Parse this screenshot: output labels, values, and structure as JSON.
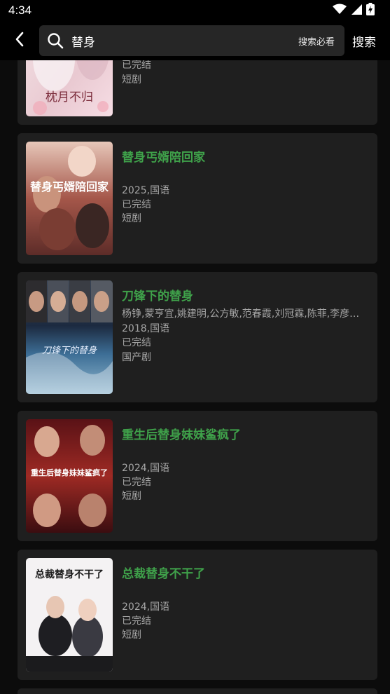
{
  "status_bar": {
    "time": "4:34"
  },
  "search": {
    "query": "替身",
    "hint": "搜索必看",
    "submit_label": "搜索"
  },
  "results": [
    {
      "title": "",
      "cast": "",
      "year_lang": "",
      "status": "已完结",
      "category": "短剧",
      "poster_text": "枕月不归"
    },
    {
      "title": "替身丐婿陪回家",
      "cast": "",
      "year_lang": "2025,国语",
      "status": "已完结",
      "category": "短剧",
      "poster_text": "替身丐婿陪回家"
    },
    {
      "title": "刀锋下的替身",
      "cast": "杨铮,蒙亨宜,姚建明,公方敏,范春霞,刘冠霖,陈菲,李彦…",
      "year_lang": "2018,国语",
      "status": "已完结",
      "category": "国产剧",
      "poster_text": "刀锋下的替身"
    },
    {
      "title": "重生后替身妹妹鲨疯了",
      "cast": "",
      "year_lang": "2024,国语",
      "status": "已完结",
      "category": "短剧",
      "poster_text": "重生后替身妹妹鲨疯了"
    },
    {
      "title": "总裁替身不干了",
      "cast": "",
      "year_lang": "2024,国语",
      "status": "已完结",
      "category": "短剧",
      "poster_text": "总裁替身不干了"
    }
  ],
  "colors": {
    "accent_title": "#3fa14a",
    "card_bg": "#1f1f1f",
    "page_bg": "#0c0c0c",
    "search_bg": "#262626"
  }
}
